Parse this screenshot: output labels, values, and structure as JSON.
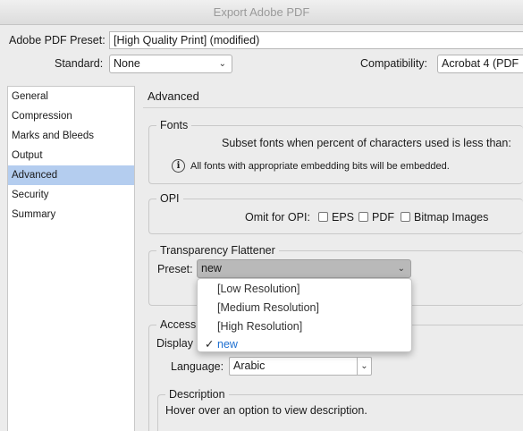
{
  "window": {
    "title": "Export Adobe PDF"
  },
  "header": {
    "preset_label": "Adobe PDF Preset:",
    "preset_value": "[High Quality Print] (modified)",
    "standard_label": "Standard:",
    "standard_value": "None",
    "compat_label": "Compatibility:",
    "compat_value": "Acrobat 4 (PDF"
  },
  "sidebar": {
    "items": [
      {
        "label": "General"
      },
      {
        "label": "Compression"
      },
      {
        "label": "Marks and Bleeds"
      },
      {
        "label": "Output"
      },
      {
        "label": "Advanced",
        "selected": true
      },
      {
        "label": "Security"
      },
      {
        "label": "Summary"
      }
    ]
  },
  "main": {
    "section_title": "Advanced",
    "fonts": {
      "title": "Fonts",
      "subset_label": "Subset fonts when percent of characters used is less than:",
      "info_text": "All fonts with appropriate embedding bits will be embedded.",
      "info_icon": "info-icon"
    },
    "opi": {
      "title": "OPI",
      "omit_label": "Omit for OPI:",
      "eps_label": "EPS",
      "pdf_label": "PDF",
      "bitmap_label": "Bitmap Images"
    },
    "transparency": {
      "title": "Transparency Flattener",
      "preset_label": "Preset:",
      "preset_value": "new",
      "menu_items": [
        {
          "label": "[Low Resolution]"
        },
        {
          "label": "[Medium Resolution]"
        },
        {
          "label": "[High Resolution]"
        },
        {
          "label": "new",
          "checked": true
        }
      ],
      "accent_color": "#1d6fd1"
    },
    "accessibility": {
      "title": "Access",
      "display_label": "Display",
      "language_label": "Language:",
      "language_value": "Arabic"
    },
    "description": {
      "title": "Description",
      "text": "Hover over an option to view description."
    }
  }
}
